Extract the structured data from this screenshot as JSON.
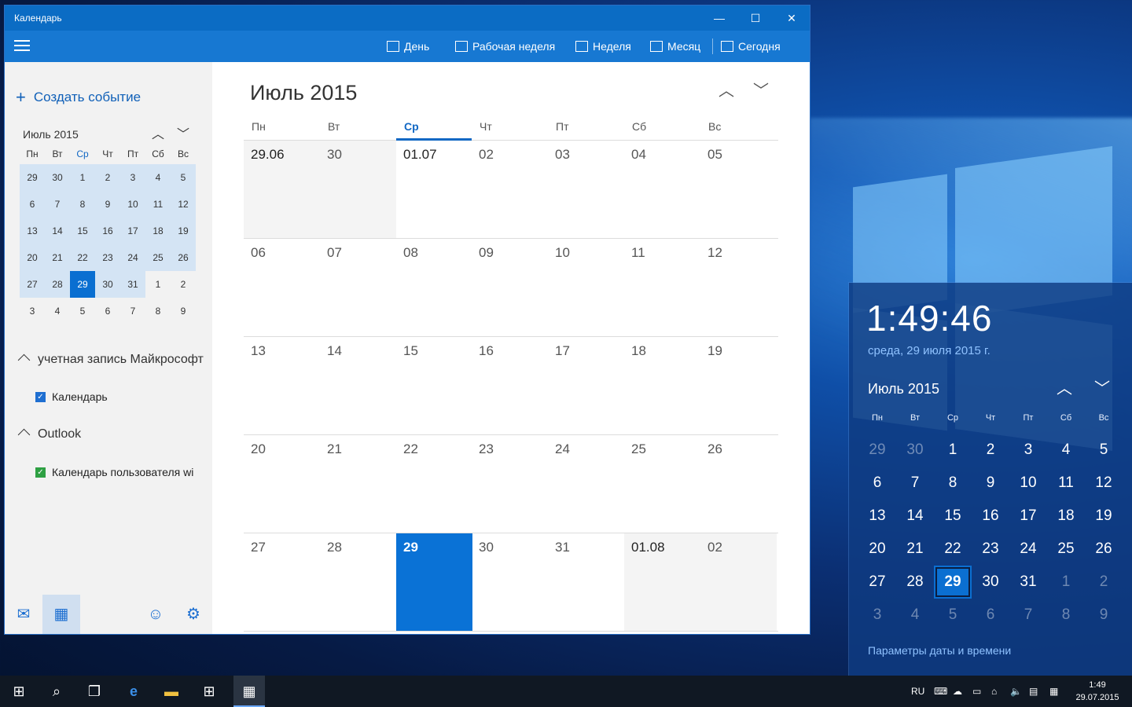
{
  "window": {
    "title": "Календарь",
    "controls": {
      "minimize": "—",
      "maximize": "☐",
      "close": "✕"
    }
  },
  "toolbar": {
    "day": "День",
    "work_week": "Рабочая неделя",
    "week": "Неделя",
    "month": "Месяц",
    "today": "Сегодня"
  },
  "sidebar": {
    "create_event": "Создать событие",
    "mini_calendar": {
      "title": "Июль 2015",
      "weekdays": [
        "Пн",
        "Вт",
        "Ср",
        "Чт",
        "Пт",
        "Сб",
        "Вс"
      ],
      "today_weekday_index": 2,
      "weeks": [
        [
          "29",
          "30",
          "1",
          "2",
          "3",
          "4",
          "5"
        ],
        [
          "6",
          "7",
          "8",
          "9",
          "10",
          "11",
          "12"
        ],
        [
          "13",
          "14",
          "15",
          "16",
          "17",
          "18",
          "19"
        ],
        [
          "20",
          "21",
          "22",
          "23",
          "24",
          "25",
          "26"
        ],
        [
          "27",
          "28",
          "29",
          "30",
          "31",
          "1",
          "2"
        ],
        [
          "3",
          "4",
          "5",
          "6",
          "7",
          "8",
          "9"
        ]
      ],
      "selected": "29"
    },
    "accounts": [
      {
        "name": "учетная запись Майкрософт",
        "calendar": "Календарь",
        "check_color": "#1f6fd1"
      },
      {
        "name": "Outlook",
        "calendar": "Календарь пользователя wi",
        "check_color": "#2ea043"
      }
    ]
  },
  "main": {
    "month_title": "Июль 2015",
    "weekdays": [
      "Пн",
      "Вт",
      "Ср",
      "Чт",
      "Пт",
      "Сб",
      "Вс"
    ],
    "today_weekday_index": 2,
    "weeks": [
      [
        "29.06",
        "30",
        "01.07",
        "02",
        "03",
        "04",
        "05"
      ],
      [
        "06",
        "07",
        "08",
        "09",
        "10",
        "11",
        "12"
      ],
      [
        "13",
        "14",
        "15",
        "16",
        "17",
        "18",
        "19"
      ],
      [
        "20",
        "21",
        "22",
        "23",
        "24",
        "25",
        "26"
      ],
      [
        "27",
        "28",
        "29",
        "30",
        "31",
        "01.08",
        "02"
      ]
    ],
    "today": "29"
  },
  "flyout": {
    "time": "1:49:46",
    "date": "среда, 29 июля 2015 г.",
    "month_title": "Июль 2015",
    "weekdays": [
      "Пн",
      "Вт",
      "Ср",
      "Чт",
      "Пт",
      "Сб",
      "Вс"
    ],
    "weeks": [
      [
        "29",
        "30",
        "1",
        "2",
        "3",
        "4",
        "5"
      ],
      [
        "6",
        "7",
        "8",
        "9",
        "10",
        "11",
        "12"
      ],
      [
        "13",
        "14",
        "15",
        "16",
        "17",
        "18",
        "19"
      ],
      [
        "20",
        "21",
        "22",
        "23",
        "24",
        "25",
        "26"
      ],
      [
        "27",
        "28",
        "29",
        "30",
        "31",
        "1",
        "2"
      ],
      [
        "3",
        "4",
        "5",
        "6",
        "7",
        "8",
        "9"
      ]
    ],
    "selected": "29",
    "settings_link": "Параметры даты и времени"
  },
  "taskbar": {
    "language": "RU",
    "time": "1:49",
    "date": "29.07.2015"
  },
  "colors": {
    "accent": "#0a72d6",
    "titlebar": "#0b6cc4",
    "toolbar": "#1778d2"
  }
}
